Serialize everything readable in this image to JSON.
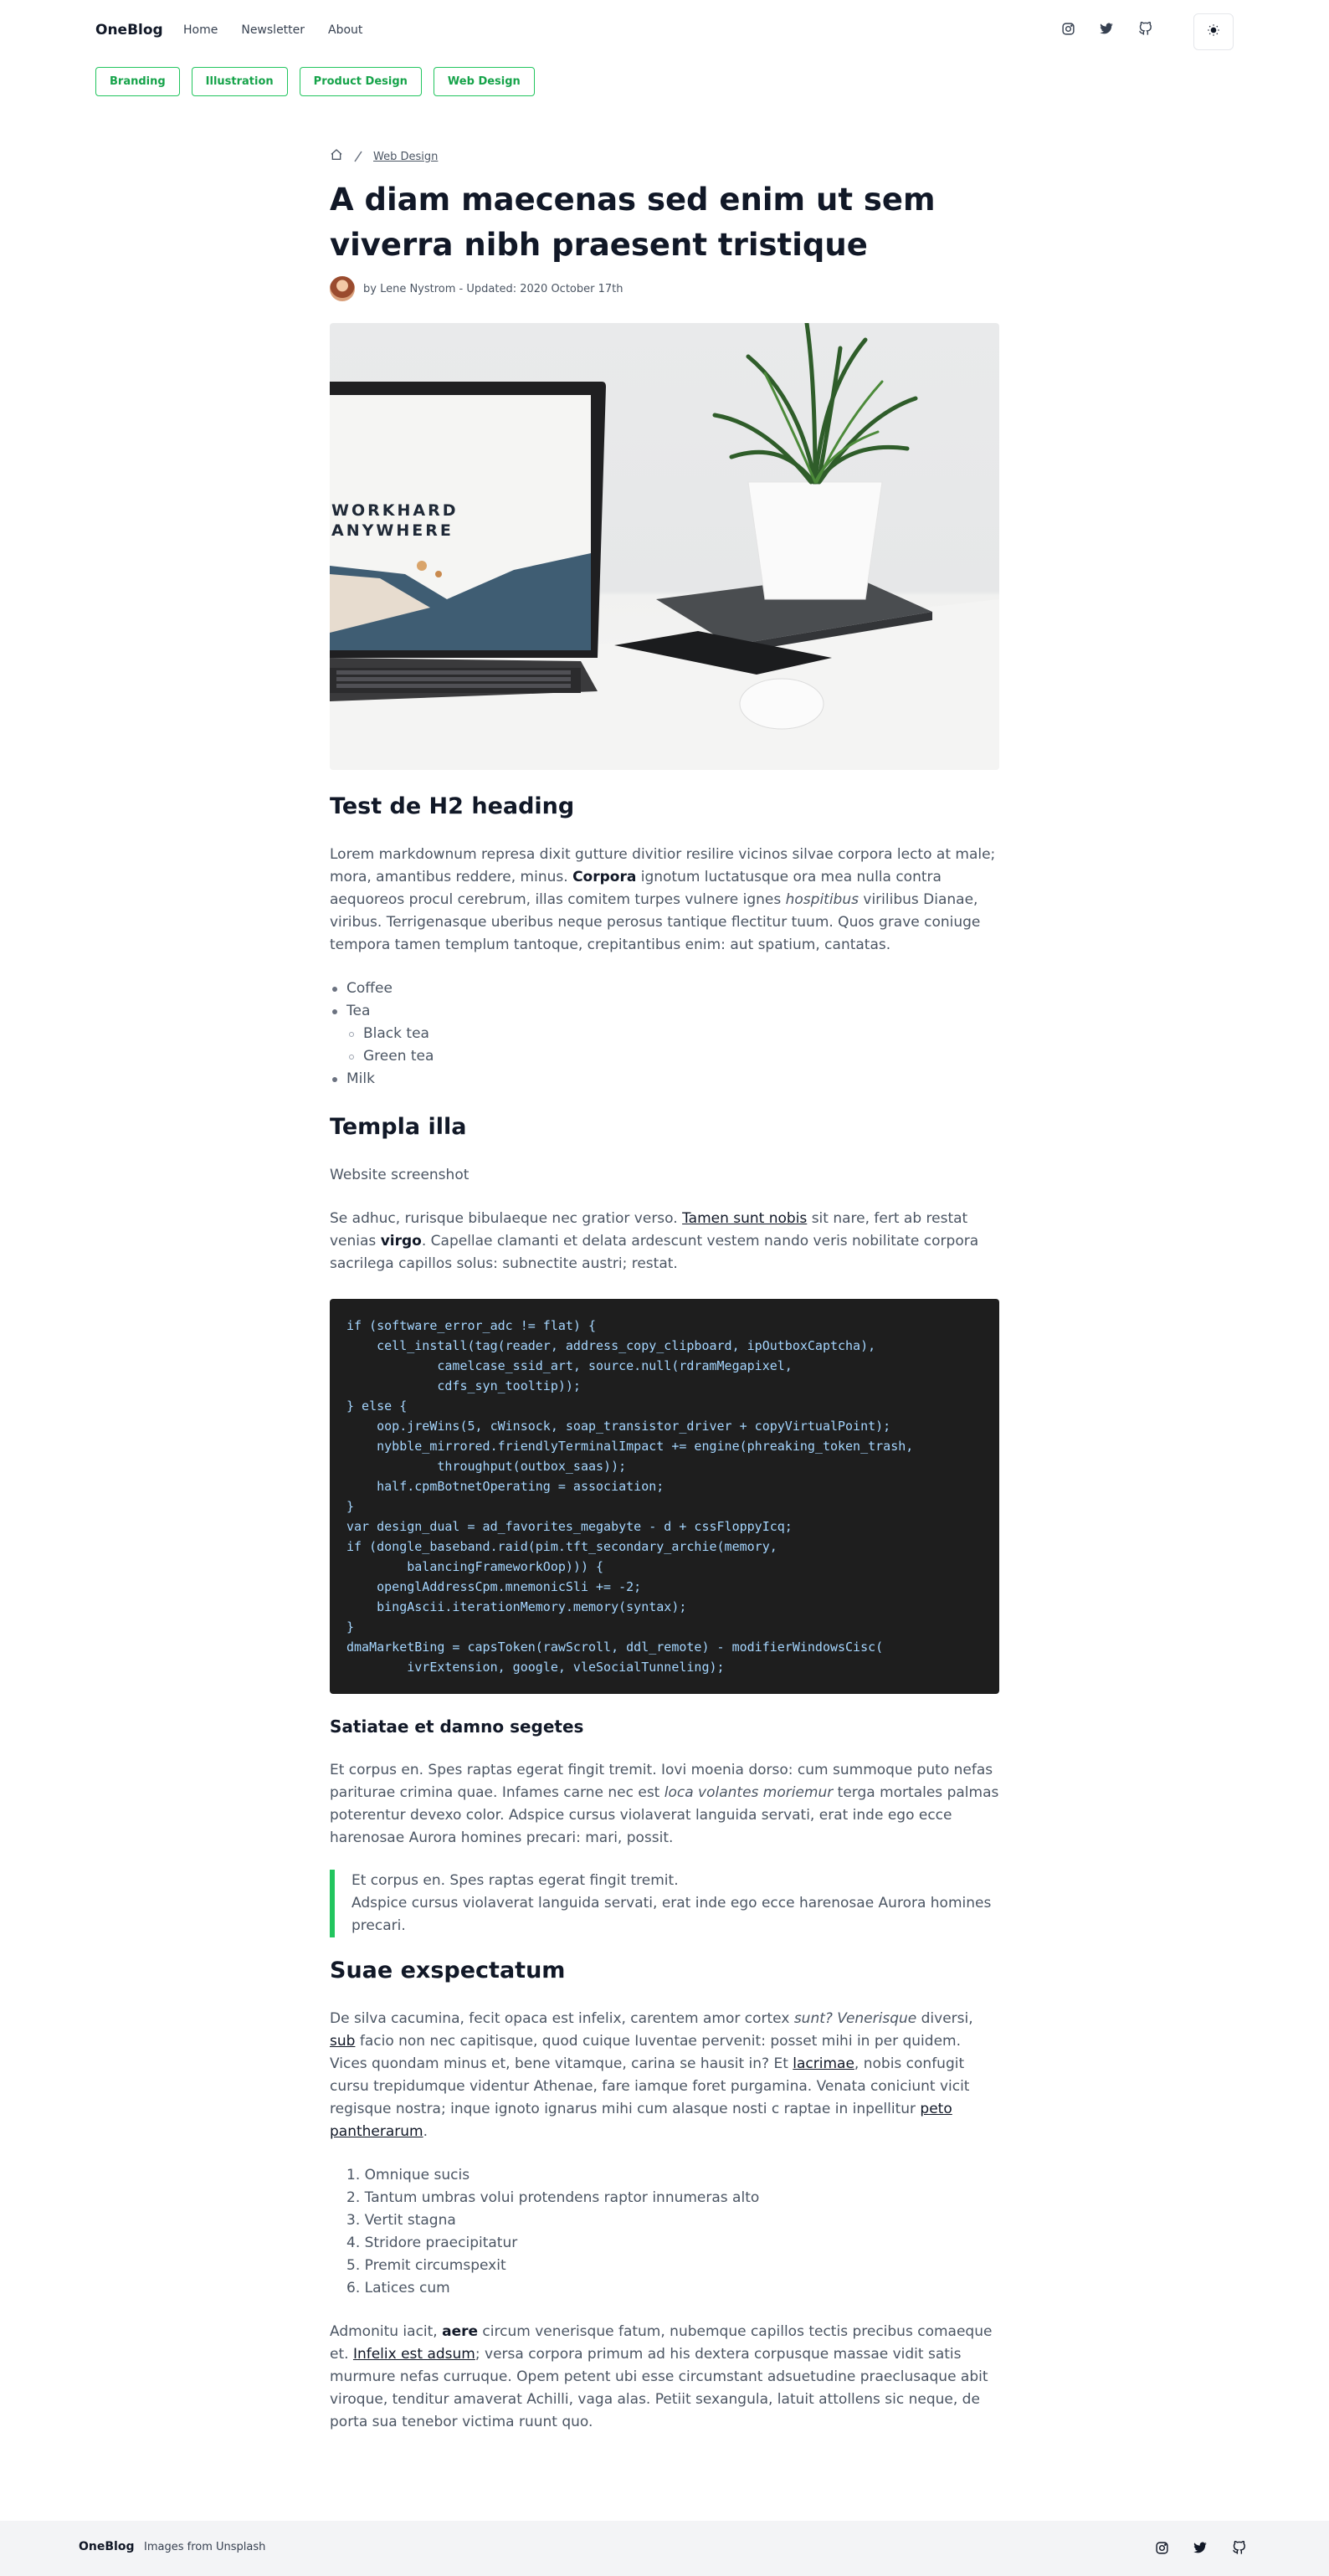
{
  "header": {
    "brand": "OneBlog",
    "nav": [
      "Home",
      "Newsletter",
      "About"
    ],
    "social_icons": [
      "instagram-icon",
      "twitter-icon",
      "github-icon"
    ],
    "theme_icon": "sun-icon"
  },
  "tags": [
    "Branding",
    "Illustration",
    "Product Design",
    "Web Design"
  ],
  "breadcrumb": {
    "home_icon": "home-icon",
    "current": "Web Design"
  },
  "post": {
    "title": "A diam maecenas sed enim ut sem viverra nibh praesent tristique",
    "byline": "by Lene Nystrom - Updated: 2020 October 17th",
    "hero_text_1": "WORKHARD",
    "hero_text_2": "ANYWHERE"
  },
  "sections": {
    "h2_1": "Test de H2 heading",
    "p1": {
      "a": "Lorem markdownum represa dixit gutture divitior resilire vicinos silvae corpora lecto at male; mora, amantibus reddere, minus. ",
      "b": "Corpora",
      "c": " ignotum luctatusque ora mea nulla contra aequoreos procul cerebrum, illas comitem turpes vulnere ignes ",
      "d": "hospitibus",
      "e": " virilibus Dianae, viribus. Terrigenasque uberibus neque perosus tantique flectitur tuum. Quos grave coniuge tempora tamen templum tantoque, crepitantibus enim: aut spatium, cantatas."
    },
    "list1": [
      "Coffee",
      "Tea",
      "Black tea",
      "Green tea",
      "Milk"
    ],
    "h2_2": "Templa illa",
    "p2": "Website screenshot",
    "p3": {
      "a": "Se adhuc, rurisque bibulaeque nec gratior verso. ",
      "link": "Tamen sunt nobis",
      "b": " sit nare, fert ab restat venias ",
      "c": "virgo",
      "d": ". Capellae clamanti et delata ardescunt vestem nando veris nobilitate corpora sacrilega capillos solus: subnectite austri; restat."
    },
    "code": "if (software_error_adc != flat) {\n    cell_install(tag(reader, address_copy_clipboard, ipOutboxCaptcha),\n            camelcase_ssid_art, source.null(rdramMegapixel,\n            cdfs_syn_tooltip));\n} else {\n    oop.jreWins(5, cWinsock, soap_transistor_driver + copyVirtualPoint);\n    nybble_mirrored.friendlyTerminalImpact += engine(phreaking_token_trash,\n            throughput(outbox_saas));\n    half.cpmBotnetOperating = association;\n}\nvar design_dual = ad_favorites_megabyte - d + cssFloppyIcq;\nif (dongle_baseband.raid(pim.tft_secondary_archie(memory,\n        balancingFrameworkOop))) {\n    openglAddressCpm.mnemonicSli += -2;\n    bingAscii.iterationMemory.memory(syntax);\n}\ndmaMarketBing = capsToken(rawScroll, ddl_remote) - modifierWindowsCisc(\n        ivrExtension, google, vleSocialTunneling);",
    "h3_1": "Satiatae et damno segetes",
    "p4": {
      "a": "Et corpus en. Spes raptas egerat fingit tremit. Iovi moenia dorso: cum summoque puto nefas pariturae crimina quae. Infames carne nec est ",
      "b": "loca volantes moriemur",
      "c": " terga mortales palmas poterentur devexo color. Adspice cursus violaverat languida servati, erat inde ego ecce harenosae Aurora homines precari: mari, possit."
    },
    "quote_1": "Et corpus en. Spes raptas egerat fingit tremit.",
    "quote_2": "Adspice cursus violaverat languida servati, erat inde ego ecce harenosae Aurora homines precari.",
    "h2_3": "Suae exspectatum",
    "p5": {
      "a": "De silva cacumina, fecit opaca est infelix, carentem amor cortex ",
      "b": "sunt? Venerisque",
      "c": " diversi, ",
      "link1": "sub",
      "d": " facio non nec capitisque, quod cuique Iuventae pervenit: posset mihi in per quidem. Vices quondam minus et, bene vitamque, carina se hausit in? Et ",
      "link2": "lacrimae",
      "e": ", nobis confugit cursu trepidumque videntur Athenae, fare iamque foret purgamina. Venata coniciunt vicit regisque nostra; inque ignoto ignarus mihi cum alasque nosti c raptae in inpellitur ",
      "link3": "peto pantherarum",
      "f": "."
    },
    "list2": [
      "1. Omnique sucis",
      "2. Tantum umbras volui protendens raptor innumeras alto",
      "3. Vertit stagna",
      "4. Stridore praecipitatur",
      "5. Premit circumspexit",
      "6. Latices cum"
    ],
    "p6": {
      "a": "Admonitu iacit, ",
      "b": "aere",
      "c": " circum venerisque fatum, nubemque capillos tectis precibus comaeque et. ",
      "link": "Infelix est adsum",
      "d": "; versa corpora primum ad his dextera corpusque massae vidit satis murmure nefas curruque. Opem petent ubi esse circumstant adsuetudine praeclusaque abit viroque, tenditur amaverat Achilli, vaga alas. Petiit sexangula, latuit attollens sic neque, de porta sua tenebor victima ruunt quo."
    }
  },
  "footer": {
    "brand": "OneBlog",
    "note": "Images from Unsplash"
  }
}
